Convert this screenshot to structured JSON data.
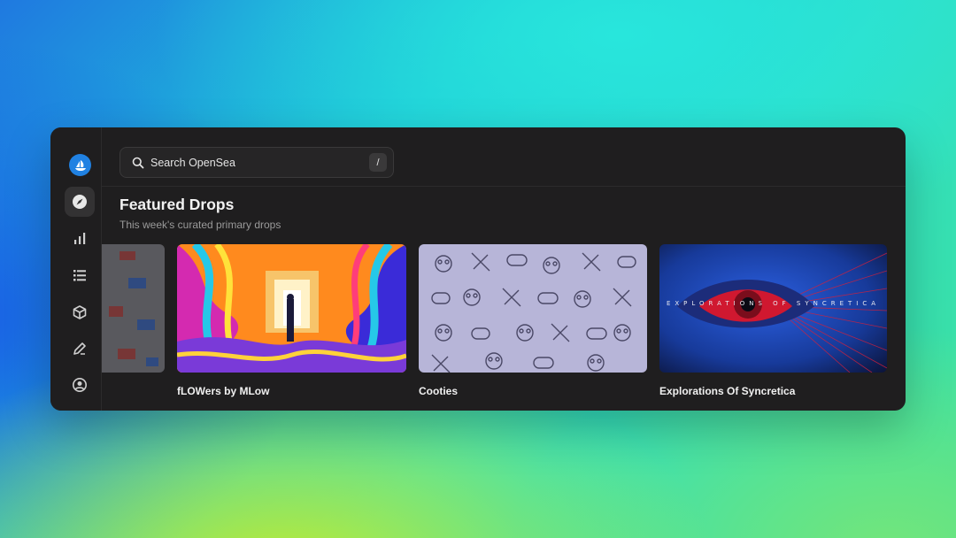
{
  "search": {
    "placeholder": "Search OpenSea",
    "shortcut": "/"
  },
  "section": {
    "title": "Featured Drops",
    "subtitle": "This week's curated primary drops"
  },
  "sidebar": {
    "items": [
      {
        "icon": "opensea-logo-icon"
      },
      {
        "icon": "compass-icon",
        "active": true
      },
      {
        "icon": "bar-chart-icon"
      },
      {
        "icon": "list-icon"
      },
      {
        "icon": "cube-icon"
      },
      {
        "icon": "pen-icon"
      },
      {
        "icon": "user-icon"
      }
    ]
  },
  "drops": [
    {
      "name": "fLOWers by MLow"
    },
    {
      "name": "Cooties"
    },
    {
      "name": "Explorations Of Syncretica",
      "overlay_text": "EXPLORATIONS OF SYNCRETICA"
    }
  ],
  "colors": {
    "window": "#1f1e1f",
    "accent": "#2081e2",
    "text": "#f2f2f2",
    "muted": "#9a9a9a"
  }
}
